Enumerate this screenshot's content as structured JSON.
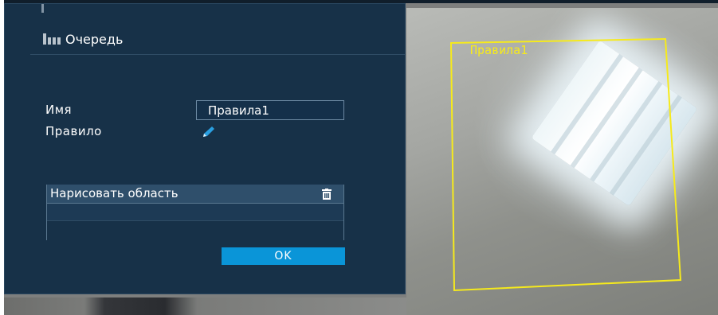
{
  "panel": {
    "title": "Очередь",
    "name_label": "Имя",
    "name_value": "Правила1",
    "rule_label": "Правило",
    "area_header": "Нарисовать область",
    "ok_label": "OK"
  },
  "camera": {
    "rule_zone_label": "Правила1"
  },
  "icons": {
    "queue": "queue-icon",
    "edit": "pencil-icon",
    "delete": "trash-icon"
  },
  "colors": {
    "panel_bg": "#173148",
    "accent": "#0a95d8",
    "rule_zone": "#f6ea1c"
  }
}
